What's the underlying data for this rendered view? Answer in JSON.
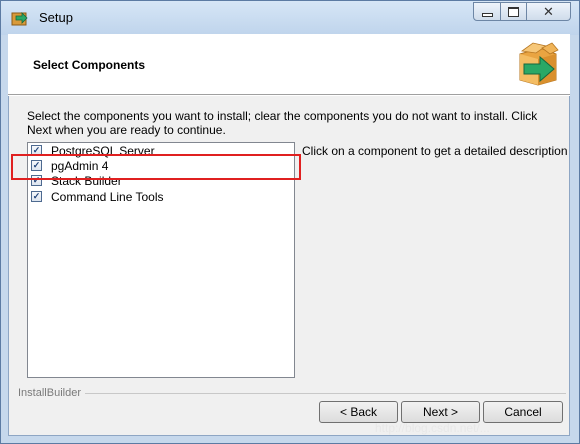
{
  "window": {
    "title": "Setup",
    "close_glyph": "✕"
  },
  "header": {
    "title": "Select Components"
  },
  "description": "Select the components you want to install; clear the components you do not want to install. Click Next when you are ready to continue.",
  "components": [
    {
      "label": "PostgreSQL Server",
      "checked": true
    },
    {
      "label": "pgAdmin 4",
      "checked": true
    },
    {
      "label": "Stack Builder",
      "checked": true
    },
    {
      "label": "Command Line Tools",
      "checked": true
    }
  ],
  "side_hint": "Click on a component to get a detailed description",
  "footer": {
    "group_label": "InstallBuilder",
    "back_label": "< Back",
    "next_label": "Next >",
    "cancel_label": "Cancel"
  },
  "watermark": "http://blog.csdn.net/...",
  "colors": {
    "highlight": "#e02020",
    "logo_box": "#e9a441",
    "logo_arrow": "#2aa866"
  }
}
